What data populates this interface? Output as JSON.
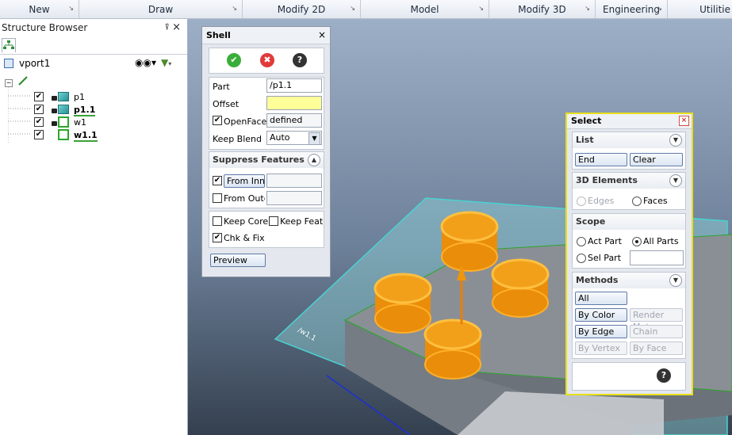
{
  "ribbon": {
    "groups": [
      "New",
      "Draw",
      "Modify 2D",
      "Model",
      "Modify 3D",
      "Engineering",
      "Utilitie"
    ]
  },
  "browser": {
    "title": "Structure Browser",
    "pin": "⍒",
    "close": "×",
    "viewport_label": "vport1",
    "tree": [
      {
        "label": "p1",
        "type": "part"
      },
      {
        "label": "p1.1",
        "type": "part"
      },
      {
        "label": "w1",
        "type": "workplane"
      },
      {
        "label": "w1.1",
        "type": "workplane"
      }
    ]
  },
  "shell": {
    "title": "Shell",
    "close": "×",
    "ok_icon": "✔",
    "cancel_icon": "✖",
    "help_icon": "?",
    "part_label": "Part",
    "part_value": "/p1.1",
    "offset_label": "Offset",
    "offset_value": "",
    "openface_label": "OpenFace",
    "openface_value": "defined",
    "keepblend_label": "Keep Blend",
    "keepblend_value": "Auto",
    "suppress_title": "Suppress Features",
    "from_inner": "From Inner",
    "from_outer": "From Oute",
    "keep_core": "Keep Core",
    "keep_feats": "Keep Feats",
    "chk_fix": "Chk & Fix",
    "preview": "Preview"
  },
  "select": {
    "title": "Select",
    "list_title": "List",
    "end": "End",
    "clear": "Clear",
    "elements_title": "3D Elements",
    "edges": "Edges",
    "faces": "Faces",
    "scope_title": "Scope",
    "act_part": "Act Part",
    "all_parts": "All Parts",
    "sel_part": "Sel Part",
    "methods_title": "Methods",
    "all": "All",
    "by_color": "By Color",
    "render_mat": "Render Mat",
    "by_edge": "By Edge",
    "chain": "Chain",
    "by_vertex": "By Vertex",
    "by_face": "By Face",
    "help_icon": "?"
  },
  "viewport": {
    "workplane_label": "/w1.1"
  },
  "colors": {
    "accent_yellow": "#f0e020",
    "selection_orange": "#f0960a",
    "ok_green": "#3aae3a",
    "cancel_red": "#e03a3a"
  }
}
